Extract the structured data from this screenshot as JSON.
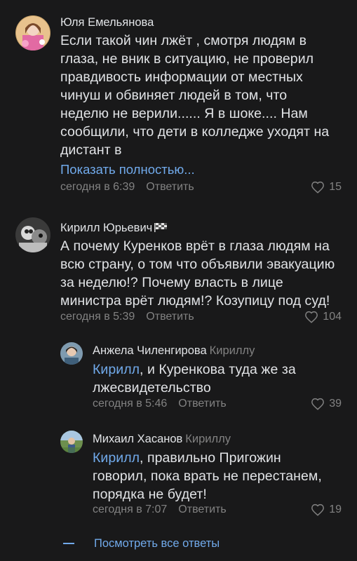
{
  "comments": [
    {
      "author": "Юля Емельянова",
      "avatar_icon": "user-avatar-pink",
      "text_lines": [
        "Если такой чин лжёт , смотря людям в",
        "глаза, не вник в ситуацию, не проверил",
        "правдивость информации от местных",
        "чинуш и обвиняет людей в том, что",
        "неделю не верили...... Я в шоке.... Нам",
        "сообщили, что дети в колледже уходят на",
        "дистант в"
      ],
      "show_more": "Показать полностью...",
      "time": "сегодня в 6:39",
      "reply_label": "Ответить",
      "likes": "15"
    },
    {
      "author": "Кирилл Юрьевич",
      "avatar_icon": "user-avatar-bw",
      "badge_icon": "checkered-flag-icon",
      "text_lines": [
        "А почему Куренков врёт в глаза людям на",
        "всю страну, о том что объявили эвакуацию",
        "за неделю!? Почему власть в лице",
        "министра врёт людям!? Козупицу под суд!"
      ],
      "time": "сегодня в 5:39",
      "reply_label": "Ответить",
      "likes": "104"
    }
  ],
  "replies": [
    {
      "author": "Анжела Чиленгирова",
      "reply_to": "Кириллу",
      "avatar_icon": "user-avatar-photo",
      "mention": "Кирилл",
      "text_first_rest": ", и Куренкова туда же за",
      "text_lines": [
        "лжесвидетельство"
      ],
      "time": "сегодня в 5:46",
      "reply_label": "Ответить",
      "likes": "39"
    },
    {
      "author": "Михаил Хасанов",
      "reply_to": "Кириллу",
      "avatar_icon": "user-avatar-outdoor",
      "mention": "Кирилл",
      "text_first_rest": ", правильно Пригожин",
      "text_lines": [
        "говорил, пока врать не перестанем,",
        "порядка не будет!"
      ],
      "time": "сегодня в 7:07",
      "reply_label": "Ответить",
      "likes": "19"
    }
  ],
  "view_all_replies": "Посмотреть все ответы",
  "colors": {
    "background": "#19191a",
    "text": "#e1e3e6",
    "secondary": "#828282",
    "accent": "#71aaeb"
  }
}
